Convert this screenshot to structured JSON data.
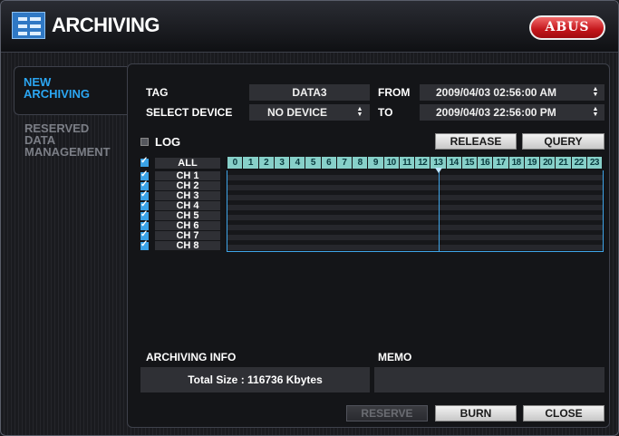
{
  "window": {
    "title": "ARCHIVING",
    "logo": "ABUS"
  },
  "tabs": [
    {
      "label_line1": "NEW",
      "label_line2": "ARCHIVING",
      "active": true
    },
    {
      "label_line1": "RESERVED",
      "label_line2": "DATA",
      "label_line3": "MANAGEMENT",
      "active": false
    }
  ],
  "form": {
    "tag_label": "TAG",
    "tag_value": "DATA3",
    "device_label": "SELECT DEVICE",
    "device_value": "NO DEVICE",
    "from_label": "FROM",
    "from_value": "2009/04/03 02:56:00 AM",
    "to_label": "TO",
    "to_value": "2009/04/03 22:56:00 PM"
  },
  "log": {
    "label": "LOG",
    "checked": false
  },
  "buttons": {
    "release": "RELEASE",
    "query": "QUERY",
    "reserve": "RESERVE",
    "burn": "BURN",
    "close": "CLOSE"
  },
  "grid": {
    "all_label": "ALL",
    "hours": [
      "0",
      "1",
      "2",
      "3",
      "4",
      "5",
      "6",
      "7",
      "8",
      "9",
      "10",
      "11",
      "12",
      "13",
      "14",
      "15",
      "16",
      "17",
      "18",
      "19",
      "20",
      "21",
      "22",
      "23"
    ],
    "channels": [
      "CH 1",
      "CH 2",
      "CH 3",
      "CH 4",
      "CH 5",
      "CH 6",
      "CH 7",
      "CH 8"
    ],
    "cursor_hour": 13
  },
  "info": {
    "archiving_label": "ARCHIVING INFO",
    "total_size": "Total Size : 116736 Kbytes",
    "memo_label": "MEMO"
  },
  "colors": {
    "accent": "#2ba6f2",
    "hour_cells": "#87d0c9",
    "logo_red": "#c3161b"
  },
  "icons": {
    "title": "archive-list-icon",
    "checkbox": "check-icon",
    "spinner": "up-down-arrows-icon"
  }
}
